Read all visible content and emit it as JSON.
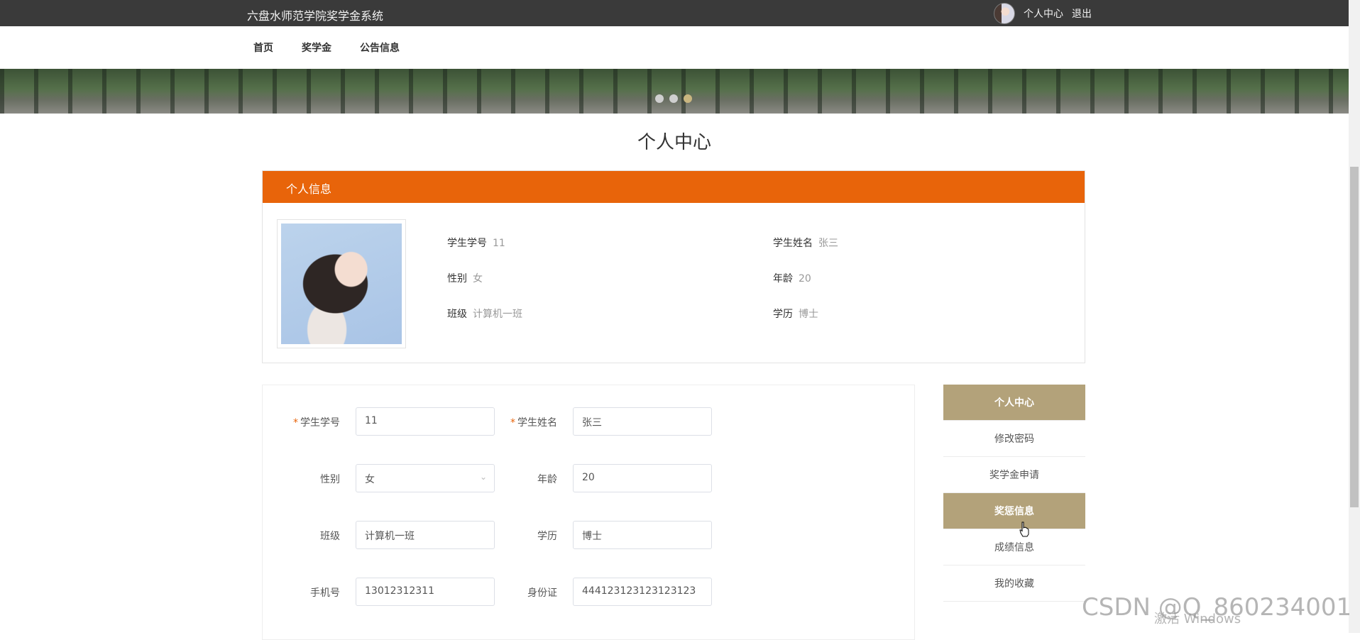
{
  "header": {
    "site_title": "六盘水师范学院奖学金系统",
    "user_center": "个人中心",
    "logout": "退出"
  },
  "nav": {
    "items": [
      "首页",
      "奖学金",
      "公告信息"
    ]
  },
  "banner": {
    "slide_count": 3,
    "active_slide": 3
  },
  "page_title": "个人中心",
  "info_card": {
    "header": "个人信息",
    "fields": [
      {
        "label": "学生学号",
        "value": "11"
      },
      {
        "label": "学生姓名",
        "value": "张三"
      },
      {
        "label": "性别",
        "value": "女"
      },
      {
        "label": "年龄",
        "value": "20"
      },
      {
        "label": "班级",
        "value": "计算机一班"
      },
      {
        "label": "学历",
        "value": "博士"
      }
    ]
  },
  "form": {
    "fields": [
      {
        "label": "学生学号",
        "value": "11",
        "required": true
      },
      {
        "label": "学生姓名",
        "value": "张三",
        "required": true
      },
      {
        "label": "性别",
        "value": "女"
      },
      {
        "label": "年龄",
        "value": "20"
      },
      {
        "label": "班级",
        "value": "计算机一班"
      },
      {
        "label": "学历",
        "value": "博士"
      },
      {
        "label": "手机号",
        "value": "13012312311"
      },
      {
        "label": "身份证",
        "value": "444123123123123123"
      }
    ],
    "required_mark": "*"
  },
  "side_menu": {
    "items": [
      "个人中心",
      "修改密码",
      "奖学金申请",
      "奖惩信息",
      "成绩信息",
      "我的收藏"
    ],
    "active": [
      "个人中心",
      "奖惩信息"
    ]
  },
  "overlay": {
    "watermark": "CSDN @Q_860234001",
    "windows_activation": "激活 Windows"
  },
  "colors": {
    "topbar": "#3a3a3a",
    "info_header": "#e8640a",
    "side_active": "#b3a27a"
  }
}
